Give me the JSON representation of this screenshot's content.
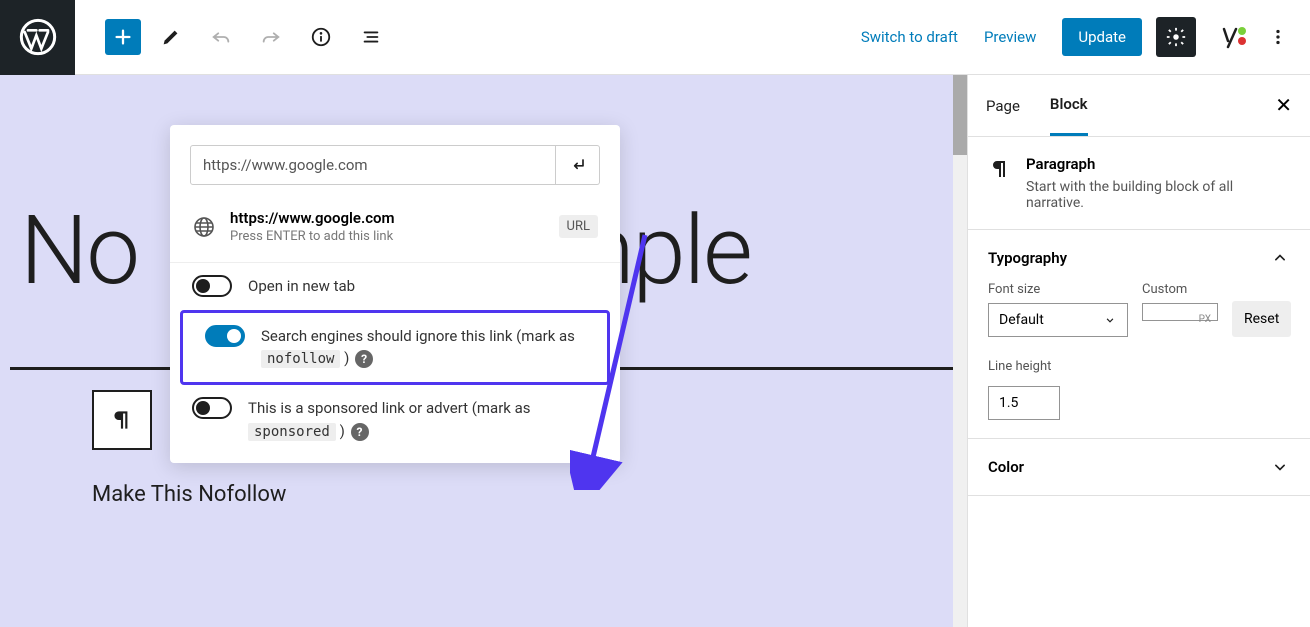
{
  "topbar": {
    "switch_to_draft": "Switch to draft",
    "preview": "Preview",
    "update": "Update"
  },
  "canvas": {
    "page_title_fragment_before": "No",
    "page_title_fragment_after": "ample",
    "body_text": "Make This Nofollow"
  },
  "link_popover": {
    "url_value": "https://www.google.com",
    "preview_url": "https://www.google.com",
    "preview_hint": "Press ENTER to add this link",
    "url_badge": "URL",
    "toggles": {
      "new_tab": {
        "label": "Open in new tab",
        "enabled": false
      },
      "nofollow": {
        "label_before": "Search engines should ignore this link (mark as ",
        "code": "nofollow",
        "label_after": " )",
        "enabled": true
      },
      "sponsored": {
        "label_before": "This is a sponsored link or advert (mark as ",
        "code": "sponsored",
        "label_after": " )",
        "enabled": false
      }
    }
  },
  "sidebar": {
    "tabs": {
      "page": "Page",
      "block": "Block"
    },
    "block_info": {
      "name": "Paragraph",
      "desc": "Start with the building block of all narrative."
    },
    "typography": {
      "title": "Typography",
      "font_size_label": "Font size",
      "font_size_value": "Default",
      "custom_label": "Custom",
      "custom_unit": "PX",
      "reset_label": "Reset",
      "line_height_label": "Line height",
      "line_height_value": "1.5"
    },
    "color": {
      "title": "Color"
    }
  }
}
